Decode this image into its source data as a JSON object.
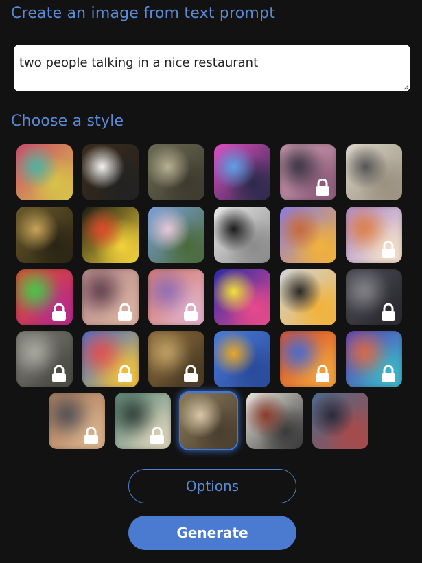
{
  "header": {
    "title": "Create an image from text prompt"
  },
  "prompt": {
    "value": "two people talking in a nice restaurant"
  },
  "styles": {
    "heading": "Choose a style",
    "tiles": [
      {
        "name": "abstract-swirl",
        "locked": false,
        "colors": [
          "#c94a6a",
          "#4fb3a3",
          "#d8c34a"
        ]
      },
      {
        "name": "panda",
        "locked": false,
        "colors": [
          "#3a2a1a",
          "#f2f2f2",
          "#222"
        ]
      },
      {
        "name": "forest-ruins",
        "locked": false,
        "colors": [
          "#6a6a52",
          "#b6b092",
          "#3d3a2e"
        ]
      },
      {
        "name": "robot",
        "locked": false,
        "colors": [
          "#e04ec0",
          "#5aa0e6",
          "#2a2a4a"
        ]
      },
      {
        "name": "anime-portrait",
        "locked": true,
        "colors": [
          "#d8a7b8",
          "#2c2c3a",
          "#8c5a7a"
        ]
      },
      {
        "name": "vintage-sketch",
        "locked": false,
        "colors": [
          "#d9d4c6",
          "#555",
          "#9a9080"
        ]
      },
      {
        "name": "mona-lisa",
        "locked": false,
        "colors": [
          "#6a5a2a",
          "#c8a45a",
          "#2a2414"
        ]
      },
      {
        "name": "flower-vase",
        "locked": false,
        "colors": [
          "#1a1a14",
          "#e04a2a",
          "#f2d23a"
        ]
      },
      {
        "name": "ballet-dancers",
        "locked": false,
        "colors": [
          "#7aa0d8",
          "#e8c8d8",
          "#4a6a3a"
        ]
      },
      {
        "name": "coffee-cup",
        "locked": false,
        "colors": [
          "#e8e8e8",
          "#1a1a1a",
          "#8a8a8a"
        ]
      },
      {
        "name": "isometric-box",
        "locked": false,
        "colors": [
          "#8a7ae0",
          "#c86a3a",
          "#f2b23a"
        ]
      },
      {
        "name": "fox",
        "locked": true,
        "colors": [
          "#a88ad8",
          "#e07a3a",
          "#f2e0c8"
        ]
      },
      {
        "name": "neon-face",
        "locked": true,
        "colors": [
          "#e04a2a",
          "#3ad84a",
          "#b82a8a"
        ]
      },
      {
        "name": "woman-portrait",
        "locked": true,
        "colors": [
          "#b88a8a",
          "#5a3a4a",
          "#d8b0a0"
        ]
      },
      {
        "name": "soft-gradient",
        "locked": true,
        "colors": [
          "#d87a6a",
          "#8a6ab8",
          "#e0b0c8"
        ]
      },
      {
        "name": "pop-art-marilyn",
        "locked": false,
        "colors": [
          "#2a2aa8",
          "#f2e23a",
          "#e84a8a"
        ]
      },
      {
        "name": "modern-house",
        "locked": false,
        "colors": [
          "#d0d4d8",
          "#2a2a28",
          "#f2b23a"
        ]
      },
      {
        "name": "dark-landscape",
        "locked": true,
        "colors": [
          "#4a4a52",
          "#8a8a90",
          "#2a2a30"
        ]
      },
      {
        "name": "grey-city",
        "locked": true,
        "colors": [
          "#7a7a72",
          "#b0b0a8",
          "#4a4a44"
        ]
      },
      {
        "name": "rainbow-figure",
        "locked": true,
        "colors": [
          "#3a6ad8",
          "#e84a4a",
          "#f2c23a"
        ]
      },
      {
        "name": "brown-abstract",
        "locked": true,
        "colors": [
          "#8a6a3a",
          "#c8a86a",
          "#4a3a24"
        ]
      },
      {
        "name": "crypto-icons",
        "locked": false,
        "colors": [
          "#4a7ad8",
          "#e8a82a",
          "#2a4a9a"
        ]
      },
      {
        "name": "fire-dragon",
        "locked": true,
        "colors": [
          "#d84a2a",
          "#3a6ae0",
          "#f2a23a"
        ]
      },
      {
        "name": "mosaic-face",
        "locked": true,
        "colors": [
          "#5a3ab8",
          "#e86a3a",
          "#3ab8c8"
        ]
      },
      {
        "name": "horned-figure",
        "locked": true,
        "colors": [
          "#a87a5a",
          "#4a4a52",
          "#d8b08a"
        ]
      },
      {
        "name": "teal-abstract",
        "locked": true,
        "colors": [
          "#5a8a7a",
          "#2a3a34",
          "#d8d0b8"
        ]
      },
      {
        "name": "victorian-girl",
        "locked": false,
        "selected": true,
        "colors": [
          "#8a7a5a",
          "#d8c8a8",
          "#4a3e2e"
        ]
      },
      {
        "name": "ink-pirate",
        "locked": false,
        "colors": [
          "#e8e4dc",
          "#8a3a2a",
          "#3a3a3a"
        ]
      },
      {
        "name": "zombie-portrait",
        "locked": false,
        "colors": [
          "#4a6a8a",
          "#2a2a3a",
          "#a84a4a"
        ]
      }
    ]
  },
  "actions": {
    "options_label": "Options",
    "generate_label": "Generate"
  }
}
